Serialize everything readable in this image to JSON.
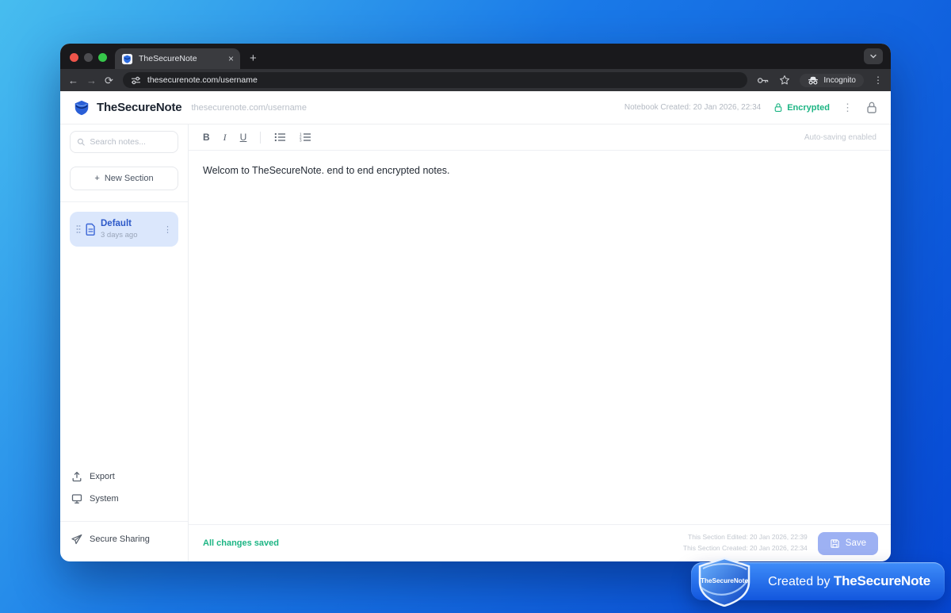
{
  "browser": {
    "tab_title": "TheSecureNote",
    "url": "thesecurenote.com/username",
    "incognito_label": "Incognito",
    "glyphs": {
      "close": "×",
      "plus": "+",
      "back": "←",
      "forward": "→",
      "reload": "⟳",
      "kebab": "⋮"
    }
  },
  "header": {
    "brand": "TheSecureNote",
    "url_display": "thesecurenote.com/username",
    "notebook_created": "Notebook Created: 20 Jan 2026, 22:34",
    "encrypted_label": "Encrypted",
    "kebab": "⋮"
  },
  "sidebar": {
    "search_placeholder": "Search notes...",
    "new_section_plus": "+",
    "new_section_label": "New Section",
    "section": {
      "name": "Default",
      "age": "3 days ago",
      "kebab": "⋮"
    },
    "export_label": "Export",
    "system_label": "System",
    "secure_sharing_label": "Secure Sharing"
  },
  "editor": {
    "toolbar": {
      "bold": "B",
      "italic": "I",
      "underline": "U"
    },
    "autosave_label": "Auto-saving enabled",
    "content": "Welcom to TheSecureNote. end to end encrypted notes.",
    "footer": {
      "status": "All changes saved",
      "edited": "This Section Edited: 20 Jan 2026, 22:39",
      "created": "This Section Created: 20 Jan 2026, 22:34",
      "save_label": "Save"
    }
  },
  "badge": {
    "created_by_prefix": "Created by ",
    "brand": "TheSecureNote",
    "shield_text": "TheSecureNote"
  },
  "colors": {
    "accent_blue": "#2d59c8",
    "status_green": "#1db584",
    "save_button": "#9db1f3",
    "section_card_bg": "#dbe7fc",
    "badge_gradient_top": "#3f8df9",
    "badge_gradient_bottom": "#1256dd"
  }
}
